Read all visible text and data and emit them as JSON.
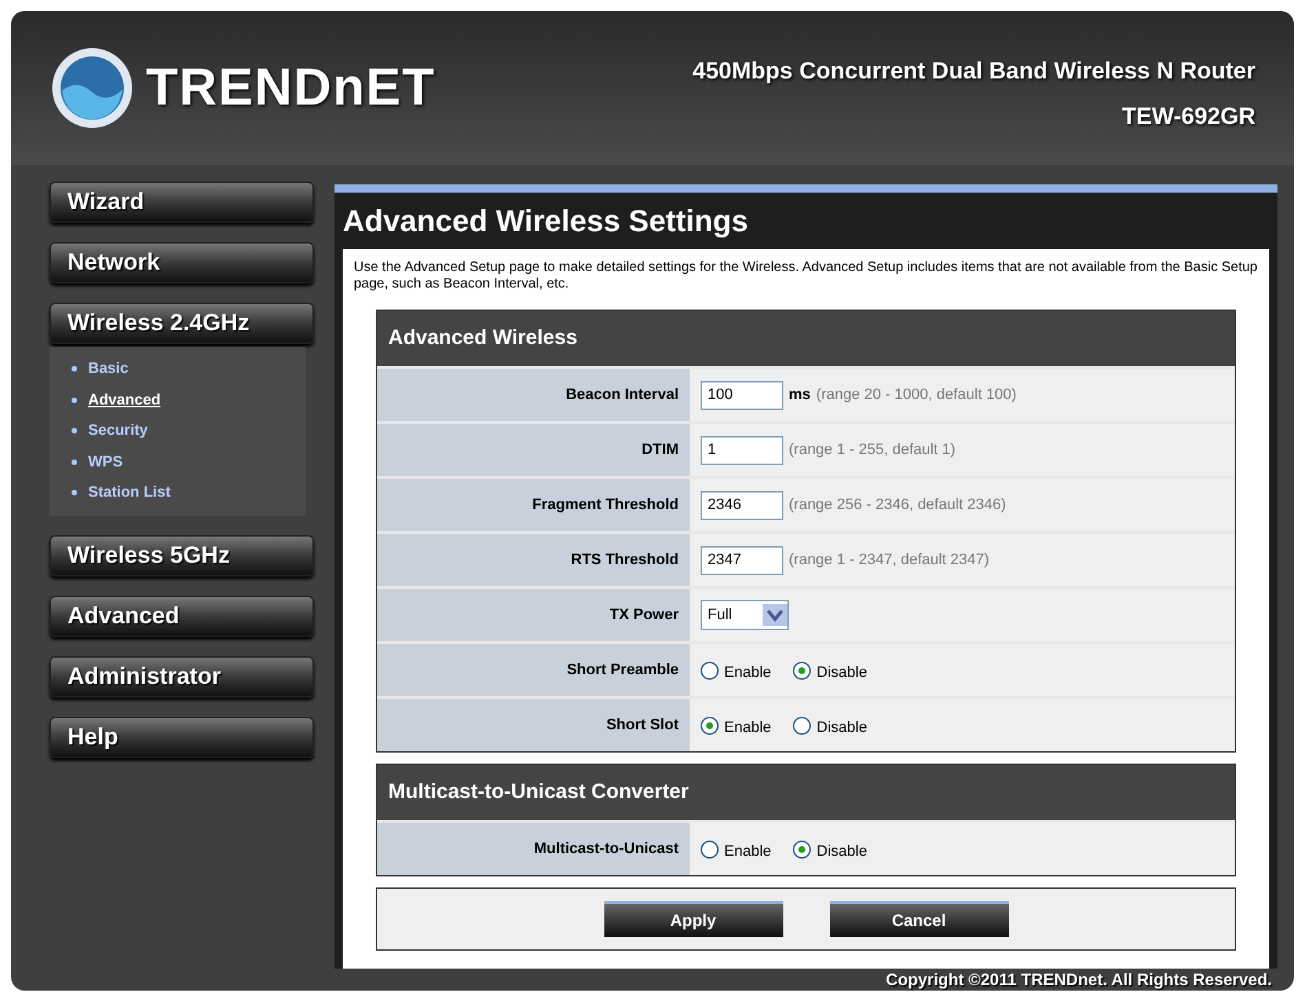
{
  "header": {
    "logo_text": "TRENDnET",
    "product": "450Mbps Concurrent Dual Band Wireless N Router",
    "model": "TEW-692GR"
  },
  "sidebar": {
    "items": [
      {
        "label": "Wizard"
      },
      {
        "label": "Network"
      },
      {
        "label": "Wireless 2.4GHz",
        "children": [
          {
            "label": "Basic",
            "selected": false
          },
          {
            "label": "Advanced",
            "selected": true
          },
          {
            "label": "Security",
            "selected": false
          },
          {
            "label": "WPS",
            "selected": false
          },
          {
            "label": "Station List",
            "selected": false
          }
        ]
      },
      {
        "label": "Wireless 5GHz"
      },
      {
        "label": "Advanced"
      },
      {
        "label": "Administrator"
      },
      {
        "label": "Help"
      }
    ]
  },
  "page": {
    "title": "Advanced Wireless Settings",
    "description": "Use the Advanced Setup page to make detailed settings for the Wireless. Advanced Setup includes items that are not available from the Basic Setup page, such as Beacon Interval, etc.",
    "sections": [
      {
        "title": "Advanced Wireless",
        "rows": [
          {
            "kind": "text",
            "label": "Beacon Interval",
            "value": "100",
            "unit": "ms",
            "hint": "(range 20 - 1000, default 100)"
          },
          {
            "kind": "text",
            "label": "DTIM",
            "value": "1",
            "hint": "(range 1 - 255, default 1)"
          },
          {
            "kind": "text",
            "label": "Fragment Threshold",
            "value": "2346",
            "hint": "(range 256 - 2346, default 2346)"
          },
          {
            "kind": "text",
            "label": "RTS Threshold",
            "value": "2347",
            "hint": "(range 1 - 2347, default 2347)"
          },
          {
            "kind": "select",
            "label": "TX Power",
            "value": "Full"
          },
          {
            "kind": "radio",
            "label": "Short Preamble",
            "options": [
              {
                "label": "Enable",
                "selected": false
              },
              {
                "label": "Disable",
                "selected": true
              }
            ]
          },
          {
            "kind": "radio",
            "label": "Short Slot",
            "options": [
              {
                "label": "Enable",
                "selected": true
              },
              {
                "label": "Disable",
                "selected": false
              }
            ]
          }
        ]
      },
      {
        "title": "Multicast-to-Unicast Converter",
        "rows": [
          {
            "kind": "radio",
            "label": "Multicast-to-Unicast",
            "options": [
              {
                "label": "Enable",
                "selected": false
              },
              {
                "label": "Disable",
                "selected": true
              }
            ]
          }
        ]
      }
    ],
    "buttons": [
      "Apply",
      "Cancel"
    ]
  },
  "footer": "Copyright ©2011 TRENDnet. All Rights Reserved."
}
